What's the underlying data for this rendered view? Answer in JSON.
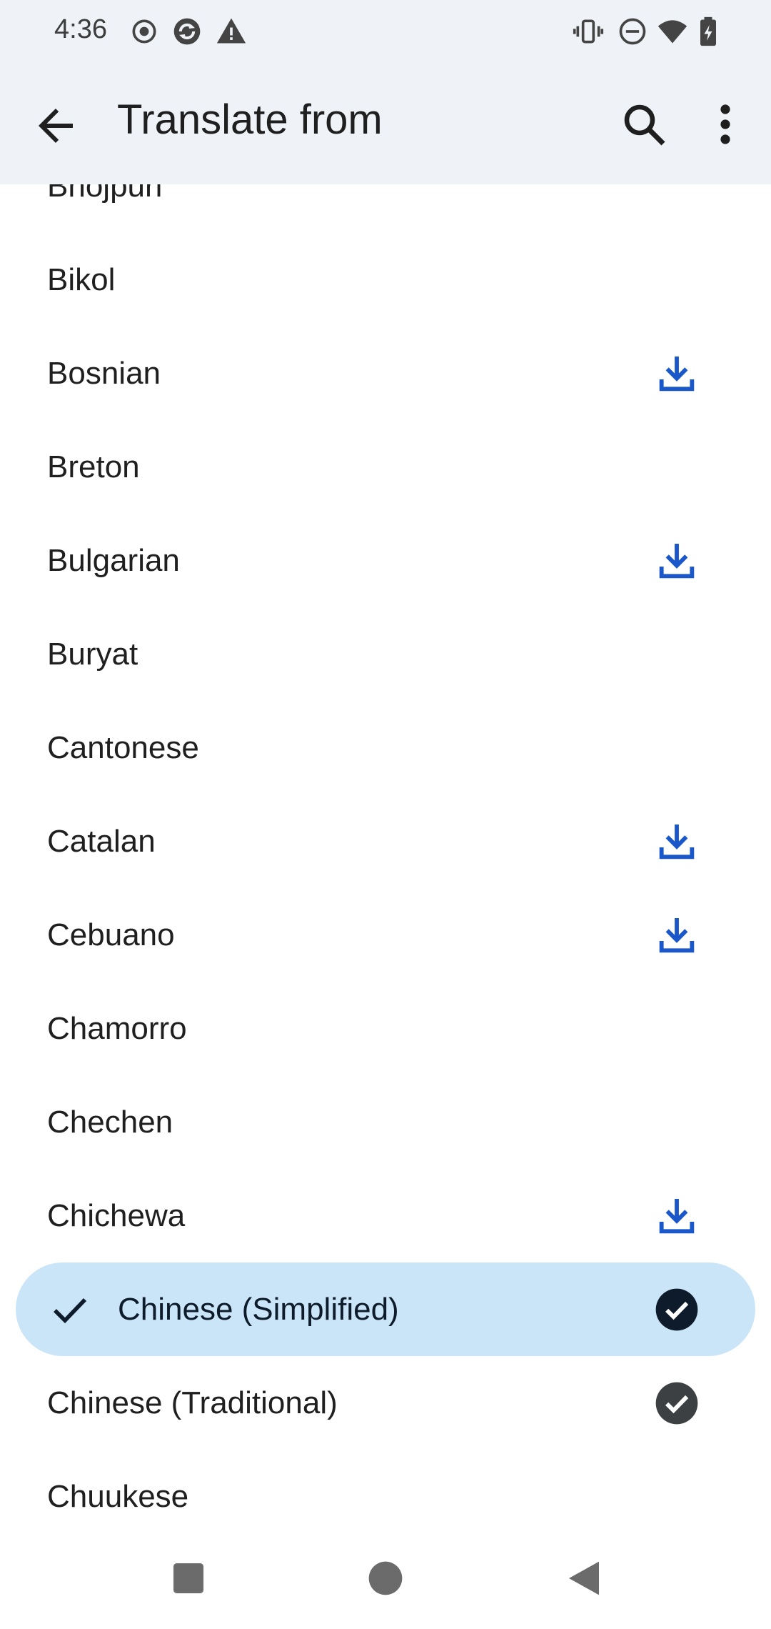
{
  "status_bar": {
    "time": "4:36",
    "left_icons": [
      "record-icon",
      "sync-icon",
      "warning-icon"
    ],
    "right_icons": [
      "vibrate-icon",
      "do-not-disturb-icon",
      "wifi-icon",
      "battery-charging-icon"
    ]
  },
  "app_bar": {
    "title": "Translate from",
    "back_icon": "arrow-back-icon",
    "search_icon": "search-icon",
    "more_icon": "more-vert-icon"
  },
  "languages": [
    {
      "label": "Bhojpuri",
      "trailing": "none",
      "selected": false
    },
    {
      "label": "Bikol",
      "trailing": "none",
      "selected": false
    },
    {
      "label": "Bosnian",
      "trailing": "download",
      "selected": false
    },
    {
      "label": "Breton",
      "trailing": "none",
      "selected": false
    },
    {
      "label": "Bulgarian",
      "trailing": "download",
      "selected": false
    },
    {
      "label": "Buryat",
      "trailing": "none",
      "selected": false
    },
    {
      "label": "Cantonese",
      "trailing": "none",
      "selected": false
    },
    {
      "label": "Catalan",
      "trailing": "download",
      "selected": false
    },
    {
      "label": "Cebuano",
      "trailing": "download",
      "selected": false
    },
    {
      "label": "Chamorro",
      "trailing": "none",
      "selected": false
    },
    {
      "label": "Chechen",
      "trailing": "none",
      "selected": false
    },
    {
      "label": "Chichewa",
      "trailing": "download",
      "selected": false
    },
    {
      "label": "Chinese (Simplified)",
      "trailing": "downloaded",
      "selected": true
    },
    {
      "label": "Chinese (Traditional)",
      "trailing": "downloaded",
      "selected": false
    },
    {
      "label": "Chuukese",
      "trailing": "none",
      "selected": false
    }
  ],
  "nav_bar": {
    "buttons": [
      "recents-icon",
      "home-icon",
      "back-triangle-icon"
    ]
  },
  "colors": {
    "app_bar_bg": "#eff3f8",
    "selected_bg": "#cbe5f8",
    "download_blue": "#1a57c9",
    "downloaded_dark": "#3c4043",
    "selected_check_bg": "#0d1b2a"
  }
}
